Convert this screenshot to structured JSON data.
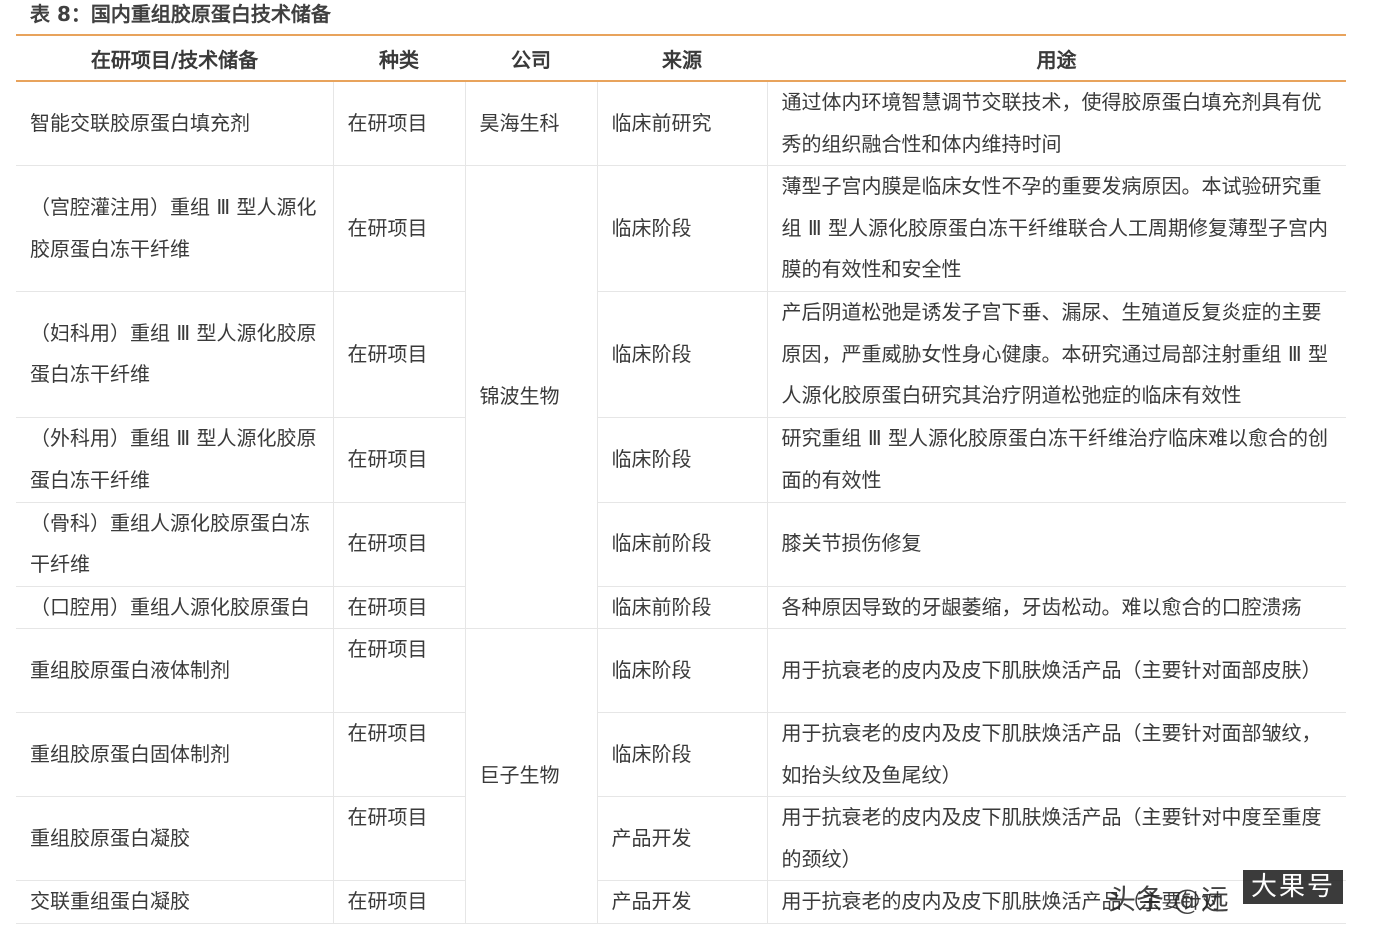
{
  "caption": "表 8：国内重组胶原蛋白技术储备",
  "headers": [
    "在研项目/技术储备",
    "种类",
    "公司",
    "来源",
    "用途"
  ],
  "companies": {
    "c1": "昊海生科",
    "c2": "锦波生物",
    "c3": "巨子生物"
  },
  "rows": [
    {
      "project": "智能交联胶原蛋白填充剂",
      "type": "在研项目",
      "source": "临床前研究",
      "use": "通过体内环境智慧调节交联技术，使得胶原蛋白填充剂具有优秀的组织融合性和体内维持时间"
    },
    {
      "project": "（宫腔灌注用）重组 Ⅲ 型人源化胶原蛋白冻干纤维",
      "type": "在研项目",
      "source": "临床阶段",
      "use": "薄型子宫内膜是临床女性不孕的重要发病原因。本试验研究重组 Ⅲ 型人源化胶原蛋白冻干纤维联合人工周期修复薄型子宫内膜的有效性和安全性"
    },
    {
      "project": "（妇科用）重组 Ⅲ 型人源化胶原蛋白冻干纤维",
      "type": "在研项目",
      "source": "临床阶段",
      "use": "产后阴道松弛是诱发子宫下垂、漏尿、生殖道反复炎症的主要原因，严重威胁女性身心健康。本研究通过局部注射重组 Ⅲ 型人源化胶原蛋白研究其治疗阴道松弛症的临床有效性"
    },
    {
      "project": "（外科用）重组 Ⅲ 型人源化胶原蛋白冻干纤维",
      "type": "在研项目",
      "source": "临床阶段",
      "use": "研究重组 Ⅲ 型人源化胶原蛋白冻干纤维治疗临床难以愈合的创面的有效性"
    },
    {
      "project": "（骨科）重组人源化胶原蛋白冻干纤维",
      "type": "在研项目",
      "source": "临床前阶段",
      "use": "膝关节损伤修复"
    },
    {
      "project": "（口腔用）重组人源化胶原蛋白",
      "type": "在研项目",
      "source": "临床前阶段",
      "use": "各种原因导致的牙龈萎缩，牙齿松动。难以愈合的口腔溃疡"
    },
    {
      "project": "重组胶原蛋白液体制剂",
      "type": "在研项目",
      "source": "临床阶段",
      "use": "用于抗衰老的皮内及皮下肌肤焕活产品（主要针对面部皮肤）"
    },
    {
      "project": "重组胶原蛋白固体制剂",
      "type": "在研项目",
      "source": "临床阶段",
      "use": "用于抗衰老的皮内及皮下肌肤焕活产品（主要针对面部皱纹，如抬头纹及鱼尾纹）"
    },
    {
      "project": "重组胶原蛋白凝胶",
      "type": "在研项目",
      "source": "产品开发",
      "use": "用于抗衰老的皮内及皮下肌肤焕活产品（主要针对中度至重度的颈纹）"
    },
    {
      "project": "交联重组蛋白凝胶",
      "type": "在研项目",
      "source": "产品开发",
      "use": "用于抗衰老的皮内及皮下肌肤焕活产品（主要针对"
    }
  ],
  "watermark": {
    "main": "头条 @远",
    "sub": "大果号"
  },
  "colors": {
    "header_border": "#e8a35c",
    "grid": "#e6e6e6",
    "text": "#3a3a3a"
  }
}
